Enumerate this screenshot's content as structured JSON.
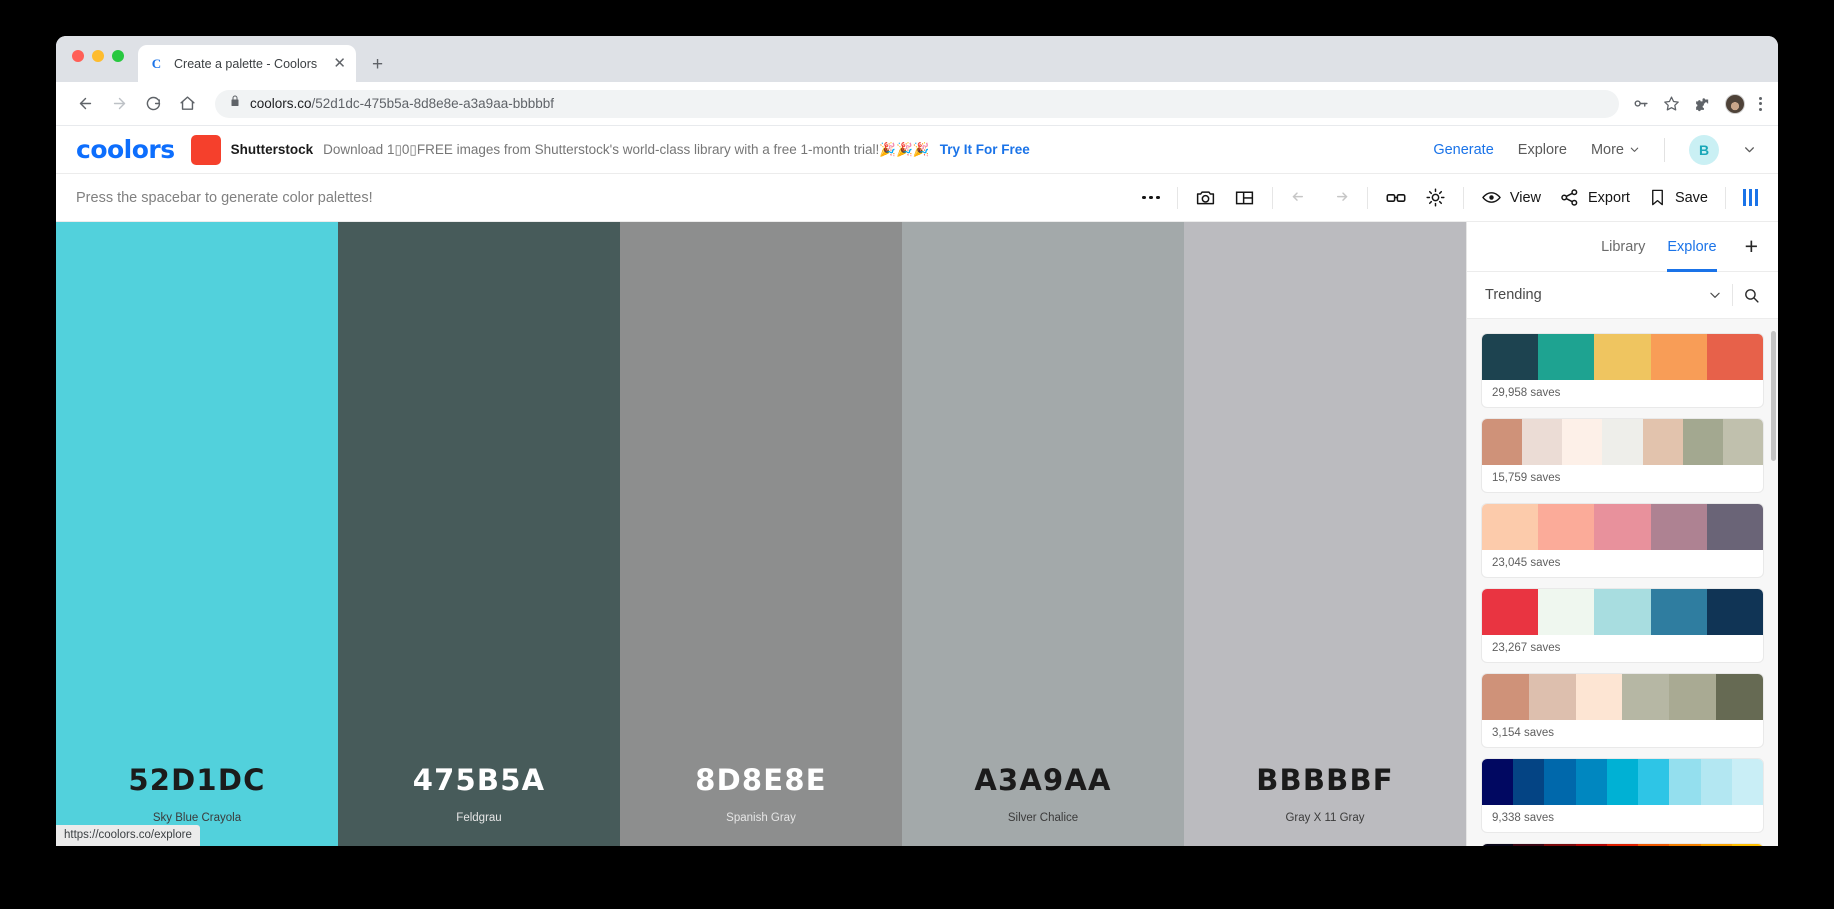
{
  "browser": {
    "tab": {
      "title": "Create a palette - Coolors",
      "favicon": "C",
      "close_label": "✕"
    },
    "new_tab_label": "+",
    "url": {
      "host": "coolors.co",
      "path": "/52d1dc-475b5a-8d8e8e-a3a9aa-bbbbbf",
      "full": "coolors.co/52d1dc-475b5a-8d8e8e-a3a9aa-bbbbbf"
    },
    "status_tooltip": "https://coolors.co/explore"
  },
  "app": {
    "logo": "coolors",
    "ad": {
      "brand": "Shutterstock",
      "text": "Download 1▯0▯FREE images from Shutterstock's world-class library with a free 1-month trial!🎉🎉🎉",
      "cta": "Try It For Free"
    },
    "nav": [
      {
        "label": "Generate",
        "active": true
      },
      {
        "label": "Explore",
        "active": false
      },
      {
        "label": "More",
        "active": false,
        "chevron": true
      }
    ],
    "avatar_initial": "B",
    "accent_color": "#1a73e8"
  },
  "toolbar": {
    "hint": "Press the spacebar to generate color palettes!",
    "view_label": "View",
    "export_label": "Export",
    "save_label": "Save"
  },
  "palette": [
    {
      "hex": "52D1DC",
      "name": "Sky Blue Crayola",
      "color": "#52d1dc",
      "text": "dark"
    },
    {
      "hex": "475B5A",
      "name": "Feldgrau",
      "color": "#475b5a",
      "text": "light"
    },
    {
      "hex": "8D8E8E",
      "name": "Spanish Gray",
      "color": "#8d8e8e",
      "text": "light"
    },
    {
      "hex": "A3A9AA",
      "name": "Silver Chalice",
      "color": "#a3a9aa",
      "text": "dark"
    },
    {
      "hex": "BBBBBF",
      "name": "Gray X 11 Gray",
      "color": "#bbbbbf",
      "text": "dark"
    }
  ],
  "sidebar": {
    "tabs": [
      {
        "label": "Library",
        "active": false
      },
      {
        "label": "Explore",
        "active": true
      }
    ],
    "add_label": "+",
    "filter": "Trending",
    "cards": [
      {
        "saves": "29,958 saves",
        "colors": [
          "#1d4350",
          "#1ea391",
          "#efc560",
          "#f89d57",
          "#e7614a"
        ]
      },
      {
        "saves": "15,759 saves",
        "colors": [
          "#cf9279",
          "#ebdcd5",
          "#fdf0e8",
          "#eeeeea",
          "#e2c3ad",
          "#a3a890",
          "#c0c0ad"
        ]
      },
      {
        "saves": "23,045 saves",
        "colors": [
          "#fccbab",
          "#fbab99",
          "#e8919c",
          "#ae8292",
          "#6a6477"
        ]
      },
      {
        "saves": "23,267 saves",
        "colors": [
          "#e93441",
          "#eff7ef",
          "#a8dde0",
          "#2f7da0",
          "#103455"
        ]
      },
      {
        "saves": "3,154 saves",
        "colors": [
          "#cf9279",
          "#ddbfae",
          "#fde5d3",
          "#b6b7a4",
          "#a9aa93",
          "#666a53"
        ]
      },
      {
        "saves": "9,338 saves",
        "colors": [
          "#010861",
          "#044484",
          "#0068ab",
          "#0087c0",
          "#00b1d4",
          "#2ec5e6",
          "#94dfee",
          "#b3e7f2",
          "#c9eef6"
        ]
      },
      {
        "saves": "",
        "colors": [
          "#090719",
          "#3c0715",
          "#7c0a0d",
          "#b20605",
          "#e02000",
          "#ef5800",
          "#f37e00",
          "#f9a300",
          "#ffbf00"
        ]
      }
    ]
  }
}
